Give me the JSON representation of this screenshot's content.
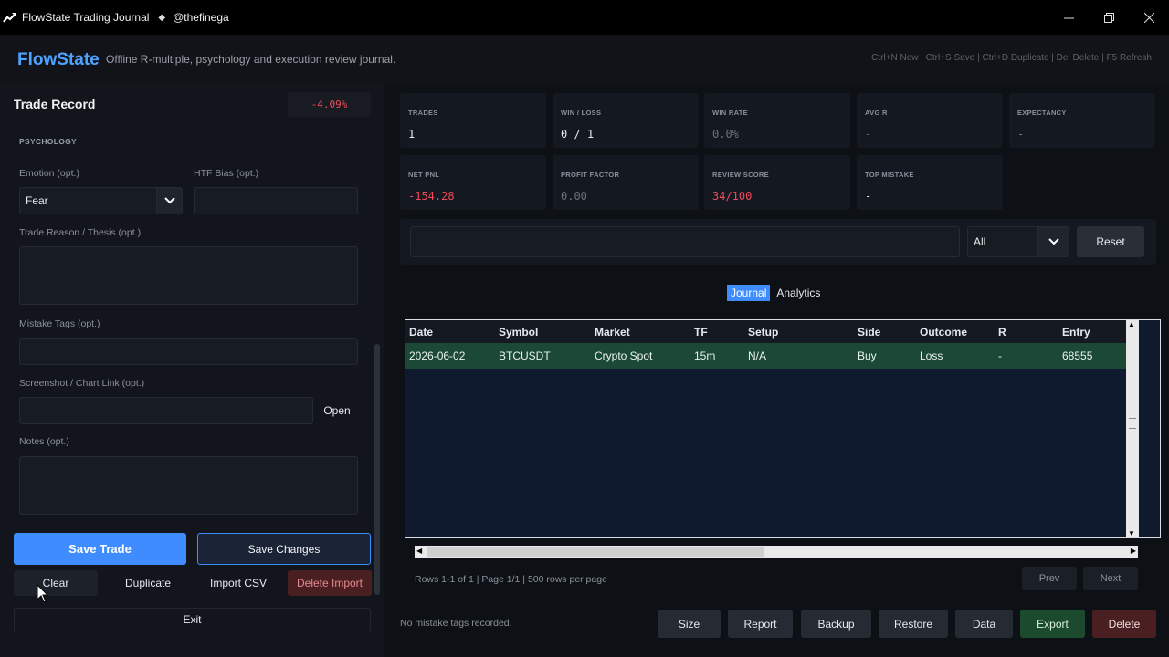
{
  "window": {
    "title": "FlowState Trading Journal",
    "user": "@thefinega"
  },
  "header": {
    "brand": "FlowState",
    "tagline": "Offline R-multiple, psychology and execution review journal.",
    "shortcuts": "Ctrl+N New | Ctrl+S Save | Ctrl+D Duplicate | Del Delete | F5 Refresh"
  },
  "form": {
    "title": "Trade Record",
    "pnl_pct": "-4.09%",
    "section": "PSYCHOLOGY",
    "emotion_label": "Emotion (opt.)",
    "emotion_value": "Fear",
    "htf_label": "HTF Bias (opt.)",
    "reason_label": "Trade Reason / Thesis (opt.)",
    "mistake_label": "Mistake Tags (opt.)",
    "screenshot_label": "Screenshot / Chart Link (opt.)",
    "open_label": "Open",
    "notes_label": "Notes (opt.)"
  },
  "actions": {
    "save_trade": "Save Trade",
    "save_changes": "Save Changes",
    "clear": "Clear",
    "duplicate": "Duplicate",
    "import_csv": "Import CSV",
    "delete_import": "Delete Import",
    "exit": "Exit"
  },
  "stats": {
    "trades_label": "TRADES",
    "trades": "1",
    "winloss_label": "WIN / LOSS",
    "winloss": "0 / 1",
    "winrate_label": "WIN RATE",
    "winrate": "0.0%",
    "avgr_label": "AVG R",
    "avgr": "-",
    "expectancy_label": "EXPECTANCY",
    "expectancy": "-",
    "netpnl_label": "NET PNL",
    "netpnl": "-154.28",
    "pf_label": "PROFIT FACTOR",
    "pf": "0.00",
    "review_label": "REVIEW SCORE",
    "review": "34/100",
    "topmistake_label": "TOP MISTAKE",
    "topmistake": "-"
  },
  "filter": {
    "search_value": "",
    "select_value": "All",
    "reset": "Reset"
  },
  "tabs": {
    "journal": "Journal",
    "analytics": "Analytics"
  },
  "table": {
    "columns": [
      "Date",
      "Symbol",
      "Market",
      "TF",
      "Setup",
      "Side",
      "Outcome",
      "R",
      "Entry"
    ],
    "rows": [
      [
        "2026-06-02",
        "BTCUSDT",
        "Crypto Spot",
        "15m",
        "N/A",
        "Buy",
        "Loss",
        "-",
        "68555"
      ]
    ]
  },
  "pagination": {
    "info": "Rows 1-1 of 1  |  Page 1/1  |  500 rows per page",
    "prev": "Prev",
    "next": "Next"
  },
  "status": "No mistake tags recorded.",
  "bottom": {
    "size": "Size",
    "report": "Report",
    "backup": "Backup",
    "restore": "Restore",
    "data": "Data",
    "export": "Export",
    "delete": "Delete"
  }
}
